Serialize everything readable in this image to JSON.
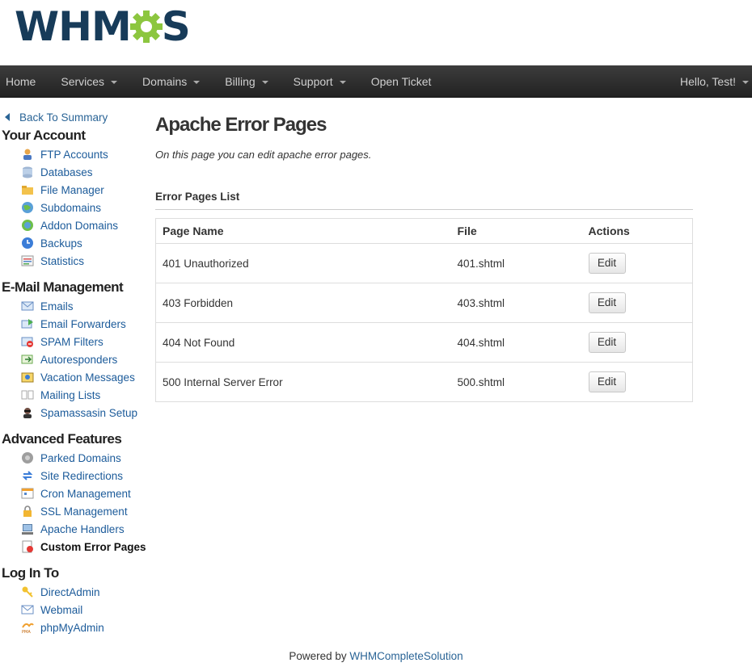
{
  "brand": {
    "logo_text_left": "WHM",
    "logo_text_right": "S",
    "gear_color": "#8cc63f",
    "text_color": "#173b59"
  },
  "nav": {
    "items": [
      {
        "label": "Home",
        "dropdown": false
      },
      {
        "label": "Services",
        "dropdown": true
      },
      {
        "label": "Domains",
        "dropdown": true
      },
      {
        "label": "Billing",
        "dropdown": true
      },
      {
        "label": "Support",
        "dropdown": true
      },
      {
        "label": "Open Ticket",
        "dropdown": false
      }
    ],
    "user": "Hello, Test!"
  },
  "sidebar": {
    "back_label": "Back To Summary",
    "sections": [
      {
        "title": "Your Account",
        "items": [
          {
            "label": "FTP Accounts",
            "icon": "ftp-user-icon"
          },
          {
            "label": "Databases",
            "icon": "database-icon"
          },
          {
            "label": "File Manager",
            "icon": "folder-icon"
          },
          {
            "label": "Subdomains",
            "icon": "globe-icon"
          },
          {
            "label": "Addon Domains",
            "icon": "globe-add-icon"
          },
          {
            "label": "Backups",
            "icon": "backup-icon"
          },
          {
            "label": "Statistics",
            "icon": "statistics-icon"
          }
        ]
      },
      {
        "title": "E-Mail Management",
        "items": [
          {
            "label": "Emails",
            "icon": "envelope-icon"
          },
          {
            "label": "Email Forwarders",
            "icon": "forward-icon"
          },
          {
            "label": "SPAM Filters",
            "icon": "spam-filter-icon"
          },
          {
            "label": "Autoresponders",
            "icon": "autoresponder-icon"
          },
          {
            "label": "Vacation Messages",
            "icon": "vacation-icon"
          },
          {
            "label": "Mailing Lists",
            "icon": "mailing-list-icon"
          },
          {
            "label": "Spamassasin Setup",
            "icon": "spy-icon"
          }
        ]
      },
      {
        "title": "Advanced Features",
        "items": [
          {
            "label": "Parked Domains",
            "icon": "parked-icon"
          },
          {
            "label": "Site Redirections",
            "icon": "redirect-icon"
          },
          {
            "label": "Cron Management",
            "icon": "calendar-icon"
          },
          {
            "label": "SSL Management",
            "icon": "lock-icon"
          },
          {
            "label": "Apache Handlers",
            "icon": "server-icon"
          },
          {
            "label": "Custom Error Pages",
            "icon": "error-page-icon",
            "active": true
          }
        ]
      },
      {
        "title": "Log In To",
        "items": [
          {
            "label": "DirectAdmin",
            "icon": "key-icon"
          },
          {
            "label": "Webmail",
            "icon": "webmail-icon"
          },
          {
            "label": "phpMyAdmin",
            "icon": "pma-icon"
          }
        ]
      }
    ]
  },
  "main": {
    "title": "Apache Error Pages",
    "description": "On this page you can edit apache error pages.",
    "list_title": "Error Pages List",
    "columns": [
      "Page Name",
      "File",
      "Actions"
    ],
    "rows": [
      {
        "name": "401 Unauthorized",
        "file": "401.shtml",
        "action": "Edit"
      },
      {
        "name": "403 Forbidden",
        "file": "403.shtml",
        "action": "Edit"
      },
      {
        "name": "404 Not Found",
        "file": "404.shtml",
        "action": "Edit"
      },
      {
        "name": "500 Internal Server Error",
        "file": "500.shtml",
        "action": "Edit"
      }
    ]
  },
  "footer": {
    "prefix": "Powered by ",
    "link": "WHMCompleteSolution"
  }
}
